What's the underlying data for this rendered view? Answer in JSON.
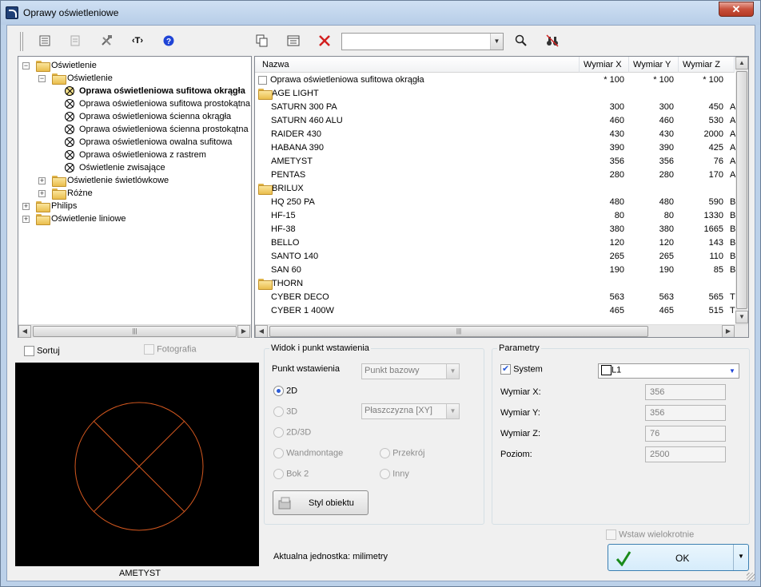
{
  "window": {
    "title": "Oprawy oświetleniowe",
    "close_label": "✕"
  },
  "toolbar": {
    "search_value": ""
  },
  "tree": [
    {
      "label": "Oświetlenie",
      "level": 0,
      "type": "folder",
      "expander": "−"
    },
    {
      "label": "Oświetlenie",
      "level": 1,
      "type": "folder",
      "expander": "−"
    },
    {
      "label": "Oprawa oświetleniowa sufitowa okrągła",
      "level": 2,
      "type": "item",
      "selected": true
    },
    {
      "label": "Oprawa oświetleniowa sufitowa prostokątna",
      "level": 2,
      "type": "item"
    },
    {
      "label": "Oprawa oświetleniowa ścienna okrągła",
      "level": 2,
      "type": "item"
    },
    {
      "label": "Oprawa oświetleniowa ścienna prostokątna",
      "level": 2,
      "type": "item"
    },
    {
      "label": "Oprawa oświetleniowa owalna sufitowa",
      "level": 2,
      "type": "item"
    },
    {
      "label": "Oprawa oświetleniowa z rastrem",
      "level": 2,
      "type": "item"
    },
    {
      "label": "Oświetlenie zwisające",
      "level": 2,
      "type": "item"
    },
    {
      "label": "Oświetlenie świetlówkowe",
      "level": 1,
      "type": "folder",
      "expander": "+"
    },
    {
      "label": "Różne",
      "level": 1,
      "type": "folder",
      "expander": "+"
    },
    {
      "label": "Philips",
      "level": 0,
      "type": "folder",
      "expander": "+"
    },
    {
      "label": "Oświetlenie liniowe",
      "level": 0,
      "type": "folder",
      "expander": "+"
    }
  ],
  "list": {
    "columns": [
      "Nazwa",
      "Wymiar X",
      "Wymiar Y",
      "Wymiar Z"
    ],
    "rows": [
      {
        "name": "Oprawa oświetleniowa sufitowa okrągła",
        "x": "* 100",
        "y": "* 100",
        "z": "* 100",
        "extra": "",
        "type": "check"
      },
      {
        "name": "AGE LIGHT",
        "x": "",
        "y": "",
        "z": "",
        "extra": "",
        "type": "folder"
      },
      {
        "name": "SATURN 300 PA",
        "x": "300",
        "y": "300",
        "z": "450",
        "extra": "A",
        "type": "item"
      },
      {
        "name": "SATURN 460 ALU",
        "x": "460",
        "y": "460",
        "z": "530",
        "extra": "A",
        "type": "item"
      },
      {
        "name": "RAIDER 430",
        "x": "430",
        "y": "430",
        "z": "2000",
        "extra": "A",
        "type": "item"
      },
      {
        "name": "HABANA 390",
        "x": "390",
        "y": "390",
        "z": "425",
        "extra": "A",
        "type": "item"
      },
      {
        "name": "AMETYST",
        "x": "356",
        "y": "356",
        "z": "76",
        "extra": "A",
        "type": "item"
      },
      {
        "name": "PENTAS",
        "x": "280",
        "y": "280",
        "z": "170",
        "extra": "A",
        "type": "item"
      },
      {
        "name": "BRILUX",
        "x": "",
        "y": "",
        "z": "",
        "extra": "",
        "type": "folder"
      },
      {
        "name": "HQ 250 PA",
        "x": "480",
        "y": "480",
        "z": "590",
        "extra": "B",
        "type": "item"
      },
      {
        "name": "HF-15",
        "x": "80",
        "y": "80",
        "z": "1330",
        "extra": "B",
        "type": "item"
      },
      {
        "name": "HF-38",
        "x": "380",
        "y": "380",
        "z": "1665",
        "extra": "B",
        "type": "item"
      },
      {
        "name": "BELLO",
        "x": "120",
        "y": "120",
        "z": "143",
        "extra": "B",
        "type": "item"
      },
      {
        "name": "SANTO 140",
        "x": "265",
        "y": "265",
        "z": "110",
        "extra": "B",
        "type": "item"
      },
      {
        "name": "SAN 60",
        "x": "190",
        "y": "190",
        "z": "85",
        "extra": "B",
        "type": "item"
      },
      {
        "name": "THORN",
        "x": "",
        "y": "",
        "z": "",
        "extra": "",
        "type": "folder"
      },
      {
        "name": "CYBER DECO",
        "x": "563",
        "y": "563",
        "z": "565",
        "extra": "T",
        "type": "item"
      },
      {
        "name": "CYBER 1 400W",
        "x": "465",
        "y": "465",
        "z": "515",
        "extra": "T",
        "type": "item"
      }
    ]
  },
  "left": {
    "sort_label": "Sortuj",
    "photo_label": "Fotografia",
    "preview_caption": "AMETYST"
  },
  "view": {
    "group_label": "Widok i punkt wstawienia",
    "insert_point_label": "Punkt wstawienia",
    "insert_point_value": "Punkt bazowy",
    "r2d": "2D",
    "r3d": "3D",
    "plane_value": "Płaszczyzna  [XY]",
    "r2d3d": "2D/3D",
    "wand": "Wandmontage",
    "przekroj": "Przekrój",
    "bok2": "Bok 2",
    "inny": "Inny",
    "style_button": "Styl obiektu"
  },
  "params": {
    "group_label": "Parametry",
    "system_label": "System",
    "layer_value": "L1",
    "wx_label": "Wymiar X:",
    "wx_value": "356",
    "wy_label": "Wymiar Y:",
    "wy_value": "356",
    "wz_label": "Wymiar Z:",
    "wz_value": "76",
    "poziom_label": "Poziom:",
    "poziom_value": "2500"
  },
  "bottom": {
    "unit_text": "Aktualna jednostka: milimetry",
    "multi_label": "Wstaw wielokrotnie",
    "ok_label": "OK"
  }
}
